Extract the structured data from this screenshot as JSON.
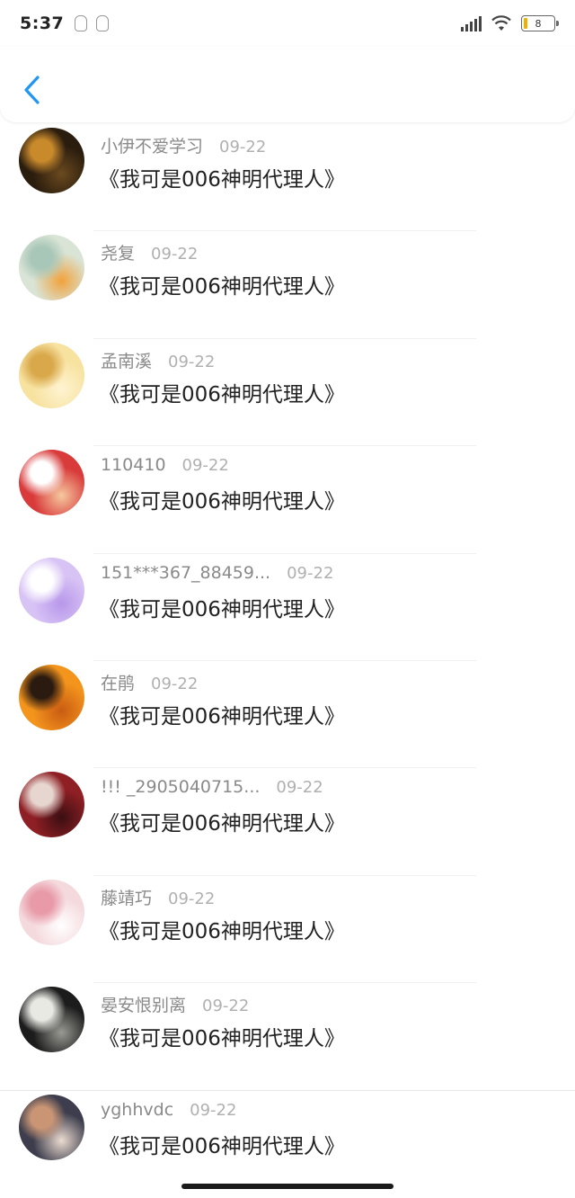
{
  "status_bar": {
    "time": "5:37",
    "battery_level": "8"
  },
  "header": {
    "back_icon": "chevron-left-icon",
    "accent_color": "#2196f3"
  },
  "comments": [
    {
      "username": "小伊不爱学习",
      "date": "09-22",
      "message": "《我可是006神明代理人》",
      "avatar_colors": [
        "#2b1d0e",
        "#c98a2c",
        "#6b4a1f"
      ]
    },
    {
      "username": "尧复",
      "date": "09-22",
      "message": "《我可是006神明代理人》",
      "avatar_colors": [
        "#d9e4d6",
        "#a9c7b8",
        "#f1a23c"
      ]
    },
    {
      "username": "孟南溪",
      "date": "09-22",
      "message": "《我可是006神明代理人》",
      "avatar_colors": [
        "#f7e2a0",
        "#d9a84a",
        "#fff4d2"
      ]
    },
    {
      "username": "110410",
      "date": "09-22",
      "message": "《我可是006神明代理人》",
      "avatar_colors": [
        "#d93b3b",
        "#ffffff",
        "#f5c9a0"
      ]
    },
    {
      "username": "151***367_88459...",
      "date": "09-22",
      "message": "《我可是006神明代理人》",
      "avatar_colors": [
        "#d8c3f5",
        "#ffffff",
        "#b797ea"
      ]
    },
    {
      "username": "在鹃",
      "date": "09-22",
      "message": "《我可是006神明代理人》",
      "avatar_colors": [
        "#f3941d",
        "#2a1a10",
        "#c95b12"
      ]
    },
    {
      "username": "!!! _2905040715...",
      "date": "09-22",
      "message": "《我可是006神明代理人》",
      "avatar_colors": [
        "#8e1f24",
        "#e7d5cf",
        "#3a0f12"
      ]
    },
    {
      "username": "藤靖巧",
      "date": "09-22",
      "message": "《我可是006神明代理人》",
      "avatar_colors": [
        "#f4d9dd",
        "#e89aa8",
        "#ffffff"
      ]
    },
    {
      "username": "晏安恨别离",
      "date": "09-22",
      "message": "《我可是006神明代理人》",
      "avatar_colors": [
        "#1c1c1c",
        "#e9e9e4",
        "#9a9a94"
      ]
    },
    {
      "username": "yghhvdc",
      "date": "09-22",
      "message": "《我可是006神明代理人》",
      "avatar_colors": [
        "#3d3d4d",
        "#c99575",
        "#ecdcd0"
      ]
    }
  ]
}
